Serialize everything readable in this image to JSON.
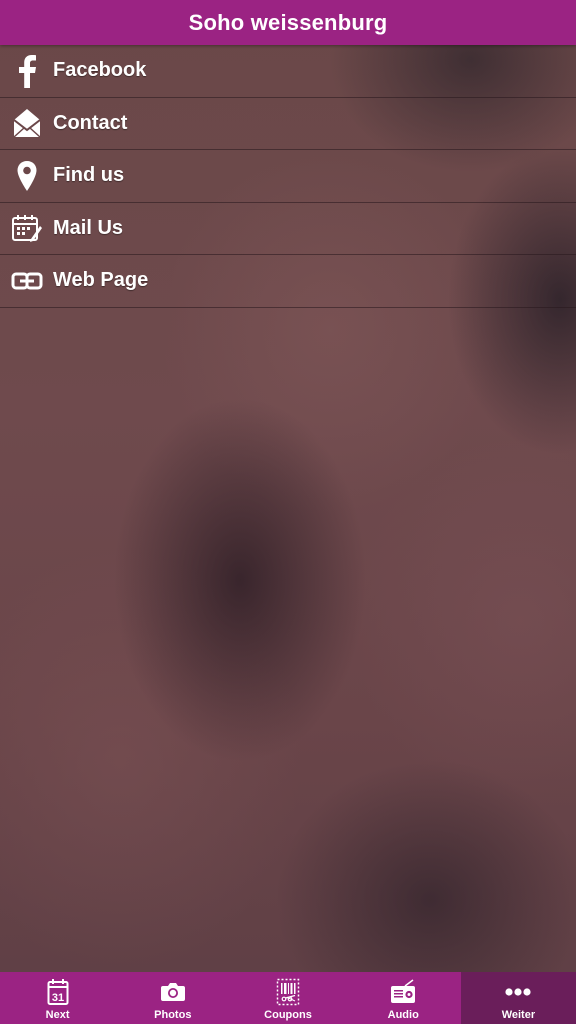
{
  "header": {
    "title": "Soho weissenburg"
  },
  "menu": {
    "items": [
      {
        "label": "Facebook",
        "icon": "facebook-icon"
      },
      {
        "label": "Contact",
        "icon": "envelope-icon"
      },
      {
        "label": "Find us",
        "icon": "map-pin-icon"
      },
      {
        "label": "Mail Us",
        "icon": "calendar-edit-icon"
      },
      {
        "label": "Web Page",
        "icon": "link-icon"
      }
    ]
  },
  "tabbar": {
    "calendar_day": "31",
    "tabs": [
      {
        "label": "Next",
        "icon": "calendar-icon",
        "active": false
      },
      {
        "label": "Photos",
        "icon": "camera-icon",
        "active": false
      },
      {
        "label": "Coupons",
        "icon": "coupon-icon",
        "active": false
      },
      {
        "label": "Audio",
        "icon": "radio-icon",
        "active": false
      },
      {
        "label": "Weiter",
        "icon": "more-icon",
        "active": true
      }
    ]
  },
  "colors": {
    "brand": "#9b2383",
    "active_tab": "#6a1e5a"
  }
}
